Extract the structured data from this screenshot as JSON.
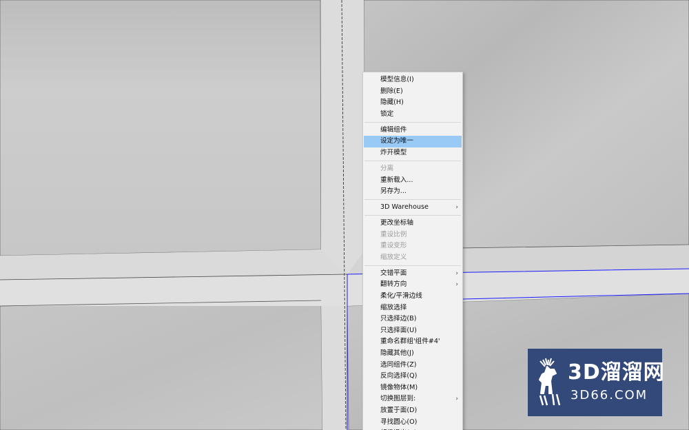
{
  "context_menu": {
    "items": [
      {
        "label": "模型信息(I)",
        "disabled": false,
        "submenu": false,
        "highlighted": false
      },
      {
        "label": "删除(E)",
        "disabled": false,
        "submenu": false,
        "highlighted": false
      },
      {
        "label": "隐藏(H)",
        "disabled": false,
        "submenu": false,
        "highlighted": false
      },
      {
        "label": "锁定",
        "disabled": false,
        "submenu": false,
        "highlighted": false
      },
      {
        "separator": true
      },
      {
        "label": "编辑组件",
        "disabled": false,
        "submenu": false,
        "highlighted": false
      },
      {
        "label": "设定为唯一",
        "disabled": false,
        "submenu": false,
        "highlighted": true
      },
      {
        "label": "炸开模型",
        "disabled": false,
        "submenu": false,
        "highlighted": false
      },
      {
        "separator": true
      },
      {
        "label": "分离",
        "disabled": true,
        "submenu": false,
        "highlighted": false
      },
      {
        "label": "重新载入...",
        "disabled": false,
        "submenu": false,
        "highlighted": false
      },
      {
        "label": "另存为...",
        "disabled": false,
        "submenu": false,
        "highlighted": false
      },
      {
        "separator": true
      },
      {
        "label": "3D Warehouse",
        "disabled": false,
        "submenu": true,
        "highlighted": false
      },
      {
        "separator": true
      },
      {
        "label": "更改坐标轴",
        "disabled": false,
        "submenu": false,
        "highlighted": false
      },
      {
        "label": "重设比例",
        "disabled": true,
        "submenu": false,
        "highlighted": false
      },
      {
        "label": "重设变形",
        "disabled": true,
        "submenu": false,
        "highlighted": false
      },
      {
        "label": "缩放定义",
        "disabled": true,
        "submenu": false,
        "highlighted": false
      },
      {
        "separator": true
      },
      {
        "label": "交错平面",
        "disabled": false,
        "submenu": true,
        "highlighted": false
      },
      {
        "label": "翻转方向",
        "disabled": false,
        "submenu": true,
        "highlighted": false
      },
      {
        "label": "柔化/平滑边线",
        "disabled": false,
        "submenu": false,
        "highlighted": false
      },
      {
        "label": "缩放选择",
        "disabled": false,
        "submenu": false,
        "highlighted": false
      },
      {
        "label": "只选择边(B)",
        "disabled": false,
        "submenu": false,
        "highlighted": false
      },
      {
        "label": "只选择面(U)",
        "disabled": false,
        "submenu": false,
        "highlighted": false
      },
      {
        "label": "重命名群组'组件#4'",
        "disabled": false,
        "submenu": false,
        "highlighted": false
      },
      {
        "label": "隐藏其他(J)",
        "disabled": false,
        "submenu": false,
        "highlighted": false
      },
      {
        "label": "选同组件(Z)",
        "disabled": false,
        "submenu": false,
        "highlighted": false
      },
      {
        "label": "反向选择(Q)",
        "disabled": false,
        "submenu": false,
        "highlighted": false
      },
      {
        "label": "镜像物体(M)",
        "disabled": false,
        "submenu": false,
        "highlighted": false
      },
      {
        "label": "切换图层到:",
        "disabled": false,
        "submenu": true,
        "highlighted": false
      },
      {
        "label": "放置于面(D)",
        "disabled": false,
        "submenu": false,
        "highlighted": false
      },
      {
        "label": "寻找圆心(O)",
        "disabled": false,
        "submenu": false,
        "highlighted": false
      },
      {
        "label": "超级退出(C)",
        "disabled": false,
        "submenu": false,
        "highlighted": false
      }
    ]
  },
  "watermark": {
    "line1": "3D溜溜网",
    "line2": "3D66.COM",
    "icon": "deer-icon",
    "bg_color": "#32497a"
  },
  "colors": {
    "highlight": "#99c9f5",
    "selection_edge": "#1a1aff",
    "menu_bg": "#f2f2f2",
    "disabled_text": "#9c9c9c"
  }
}
